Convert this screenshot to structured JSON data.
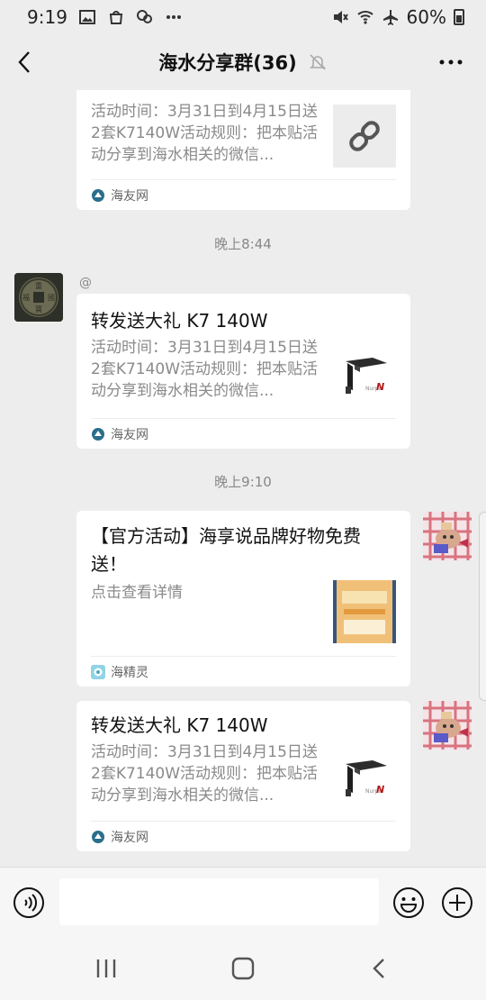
{
  "status_bar": {
    "time": "9:19",
    "battery": "60%"
  },
  "header": {
    "title": "海水分享群(36)"
  },
  "messages": [
    {
      "desc": "活动时间：3月31日到4月15日送2套K7140W活动规则：把本贴活动分享到海水相关的微信...",
      "source": "海友网"
    },
    {
      "time": "晚上8:44",
      "sender": "@",
      "title": "转发送大礼 K7 140W",
      "desc": "活动时间：3月31日到4月15日送2套K7140W活动规则：把本贴活动分享到海水相关的微信...",
      "source": "海友网"
    },
    {
      "time": "晚上9:10",
      "title": "【官方活动】海享说品牌好物免费送！",
      "desc": "点击查看详情",
      "source": "海精灵"
    },
    {
      "title": "转发送大礼 K7 140W",
      "desc": "活动时间：3月31日到4月15日送2套K7140W活动规则：把本贴活动分享到海水相关的微信...",
      "source": "海友网"
    }
  ],
  "colors": {
    "background": "#ededed",
    "card": "#ffffff",
    "muted_text": "#8a8a8a"
  }
}
